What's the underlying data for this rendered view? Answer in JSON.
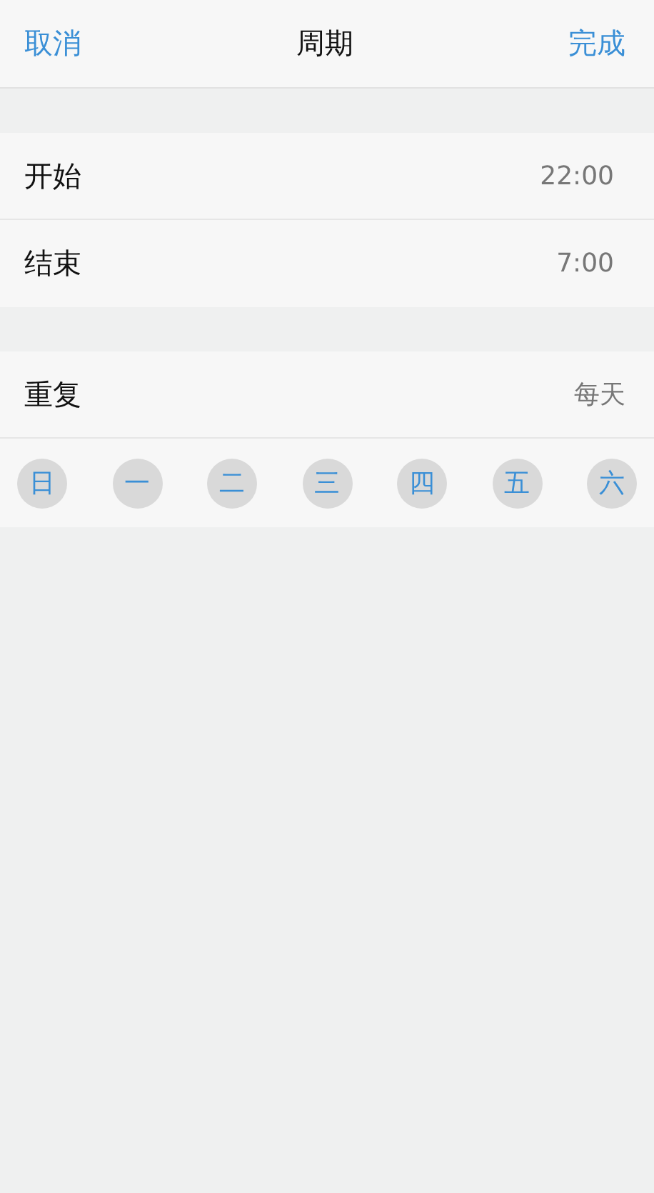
{
  "nav": {
    "cancel": "取消",
    "title": "周期",
    "done": "完成"
  },
  "time_rows": [
    {
      "label": "开始",
      "value": "22:00"
    },
    {
      "label": "结束",
      "value": "7:00"
    }
  ],
  "repeat": {
    "label": "重复",
    "value": "每天"
  },
  "days": [
    {
      "label": "日",
      "selected": true
    },
    {
      "label": "一",
      "selected": true
    },
    {
      "label": "二",
      "selected": true
    },
    {
      "label": "三",
      "selected": true
    },
    {
      "label": "四",
      "selected": true
    },
    {
      "label": "五",
      "selected": true
    },
    {
      "label": "六",
      "selected": true
    }
  ]
}
